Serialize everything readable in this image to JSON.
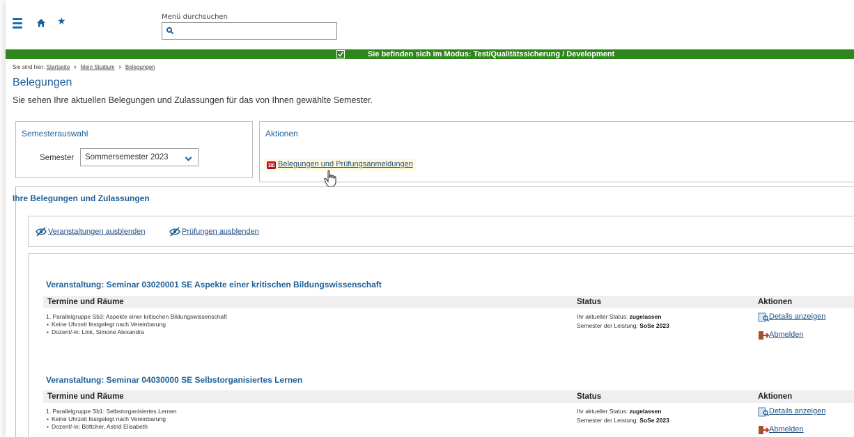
{
  "header": {
    "search_label": "Menü durchsuchen",
    "search_value": ""
  },
  "banner": {
    "text": "Sie befinden sich im Modus: Test/Qualitätssicherung / Development",
    "color": "#2f861c"
  },
  "breadcrumb": {
    "prefix": "Sie sind hier:",
    "items": [
      "Startseite",
      "Mein Studium",
      "Belegungen"
    ]
  },
  "page": {
    "title": "Belegungen",
    "description": "Sie sehen Ihre aktuellen Belegungen und Zulassungen für das von Ihnen gewählte Semester."
  },
  "semester_panel": {
    "title": "Semesterauswahl",
    "label": "Semester",
    "selected": "Sommersemester 2023"
  },
  "actions_panel": {
    "title": "Aktionen",
    "link": "Belegungen und Prüfungsanmeldungen"
  },
  "enrollments": {
    "title": "Ihre Belegungen und Zulassungen",
    "toggle_courses": "Veranstaltungen ausblenden",
    "toggle_exams": "Prüfungen ausblenden",
    "headers": {
      "termine": "Termine und Räume",
      "status": "Status",
      "aktionen": "Aktionen"
    },
    "courses": [
      {
        "title": "Veranstaltung: Seminar 03020001 SE Aspekte einer kritischen Bildungswissenschaft",
        "group": "1. Parallelgruppe Sb3: Aspekte einer kritischen Bildungswissenschaft",
        "time": "Keine Uhrzeit festgelegt nach Vereinbarung",
        "lecturer": "Dozent/-in: Link, Simone Alexandra",
        "status_label": "Ihr aktueller Status:",
        "status_value": "zugelassen",
        "semester_label": "Semester der Leistung:",
        "semester_value": "SoSe 2023",
        "details": "Details anzeigen",
        "unsubscribe": "Abmelden"
      },
      {
        "title": "Veranstaltung: Seminar 04030000 SE Selbstorganisiertes Lernen",
        "group": "1. Parallelgruppe Sb1: Selbstorganisiertes Lernen",
        "time": "Keine Uhrzeit festgelegt nach Vereinbarung",
        "lecturer": "Dozent/-in: Böttcher, Astrid Elisabeth",
        "status_label": "Ihr aktueller Status:",
        "status_value": "zugelassen",
        "semester_label": "Semester der Leistung:",
        "semester_value": "SoSe 2023",
        "details": "Details anzeigen",
        "unsubscribe": "Abmelden"
      }
    ]
  }
}
